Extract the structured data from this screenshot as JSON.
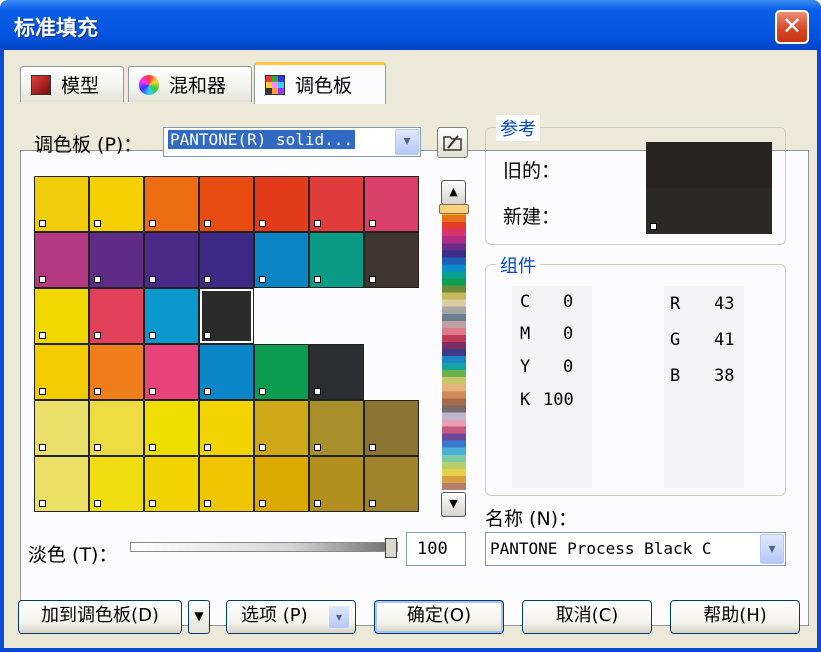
{
  "window": {
    "title": "标准填充",
    "close_glyph": "✕"
  },
  "tabs": [
    {
      "label": "模型",
      "icon": "model-swatch-icon"
    },
    {
      "label": "混和器",
      "icon": "color-wheel-icon"
    },
    {
      "label": "调色板",
      "icon": "palette-grid-icon"
    }
  ],
  "palette": {
    "label": "调色板 (P)：",
    "combo_value": "PANTONE(R) solid...",
    "dropdown_glyph": "▾"
  },
  "swatches": [
    [
      "#f0cc0a",
      "#f4d000",
      "#ef6d12",
      "#e84b10",
      "#e33c1a",
      "#e03c3c",
      "#da3f6a"
    ],
    [
      "#b43882",
      "#5e2c86",
      "#4a2a88",
      "#3d2a86",
      "#0b84c4",
      "#0a9b86",
      "#3d3730"
    ],
    [
      "#f1d900",
      "#e2405a",
      "#0b98cf",
      "#2b2b2b",
      null,
      null,
      null
    ],
    [
      "#f2cc00",
      "#ee7d1a",
      "#e8437a",
      "#0b86c8",
      "#0c9d50",
      "#2a2e30",
      null
    ],
    [
      "#ebe06a",
      "#eedd40",
      "#f0de00",
      "#f1d400",
      "#cfa818",
      "#a7902c",
      "#8b7432"
    ],
    [
      "#ede066",
      "#f0de10",
      "#f0d300",
      "#f0c600",
      "#dca900",
      "#b38f20",
      "#9e822c"
    ]
  ],
  "strip_colors": [
    "#f0b400",
    "#e8701a",
    "#e43c2a",
    "#d9336d",
    "#b22c86",
    "#6a2d88",
    "#3b2d8a",
    "#1f5fb8",
    "#0b8dc9",
    "#0aa08e",
    "#0c9f52",
    "#6a8c3a",
    "#c8b860",
    "#d9cda6",
    "#a6a6a6",
    "#6d7f8c",
    "#bda0a6",
    "#e07a84",
    "#c23c5a",
    "#7a2d62",
    "#3d3a8c",
    "#1c86c6",
    "#18a3a0",
    "#6ab24a",
    "#c9c36a",
    "#e2b27a",
    "#d08a5a",
    "#a66a4a",
    "#7a6a6a",
    "#b9b9c9",
    "#e6a0b4",
    "#c85a7e",
    "#6b4a9a",
    "#3a7ad2",
    "#4ab2d8",
    "#7acaa4",
    "#b4d06a",
    "#e6d24a",
    "#d8a040",
    "#b48070"
  ],
  "reference": {
    "title": "参考",
    "old_label": "旧的：",
    "new_label": "新建：",
    "old_color": "#272421",
    "new_color": "#2b2926"
  },
  "components": {
    "title": "组件",
    "cmyk": [
      {
        "k": "C",
        "v": "0"
      },
      {
        "k": "M",
        "v": "0"
      },
      {
        "k": "Y",
        "v": "0"
      },
      {
        "k": "K",
        "v": "100"
      }
    ],
    "rgb": [
      {
        "k": "R",
        "v": "43"
      },
      {
        "k": "G",
        "v": "41"
      },
      {
        "k": "B",
        "v": "38"
      }
    ]
  },
  "name": {
    "label": "名称 (N)：",
    "value": "PANTONE Process Black C"
  },
  "tint": {
    "label": "淡色 (T)：",
    "value": "100"
  },
  "buttons": {
    "add_to_palette": "加到调色板(D)",
    "options": "选项 (P)",
    "ok": "确定(O)",
    "cancel": "取消(C)",
    "help": "帮助(H)",
    "down_glyph": "▼",
    "up_glyph": "▲"
  }
}
